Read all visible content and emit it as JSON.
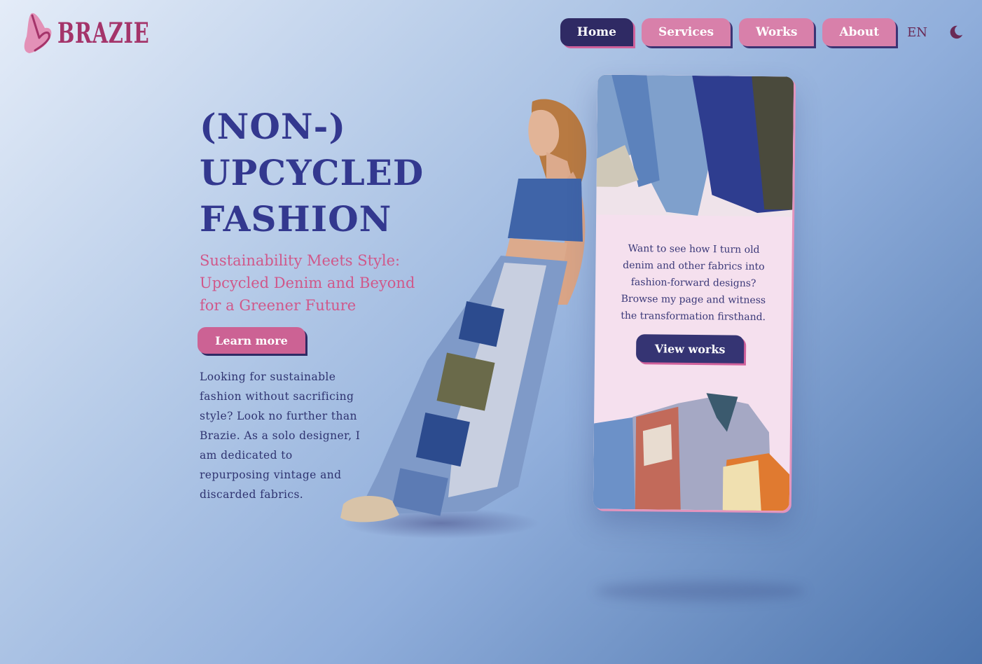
{
  "brand": {
    "name": "Brazie",
    "logo_text": "BRAZIE",
    "accent": "#a4346a"
  },
  "nav": {
    "items": [
      {
        "label": "Home",
        "active": true
      },
      {
        "label": "Services",
        "active": false
      },
      {
        "label": "Works",
        "active": false
      },
      {
        "label": "About",
        "active": false
      }
    ],
    "language": "EN",
    "theme_icon": "moon-icon"
  },
  "hero": {
    "title_lines": [
      "(NON-)",
      "UPCYCLED",
      "FASHION"
    ],
    "subtitle": "Sustainability Meets Style: Upcycled Denim and Beyond for a Greener Future",
    "cta_label": "Learn more",
    "intro": "Looking for sustainable fashion without sacrificing style? Look no further than Brazie. As a solo designer, I am dedicated to repurposing vintage and discarded fabrics."
  },
  "card": {
    "text": "Want to see how I turn old denim and other fabrics into fashion-forward designs? Browse my page and witness the transformation firsthand.",
    "cta_label": "View works"
  },
  "colors": {
    "title": "#33388f",
    "subtitle": "#d0588a",
    "pink_button": "#cc6294",
    "dark_button": "#353473",
    "card_bg": "#f5e0ee"
  }
}
